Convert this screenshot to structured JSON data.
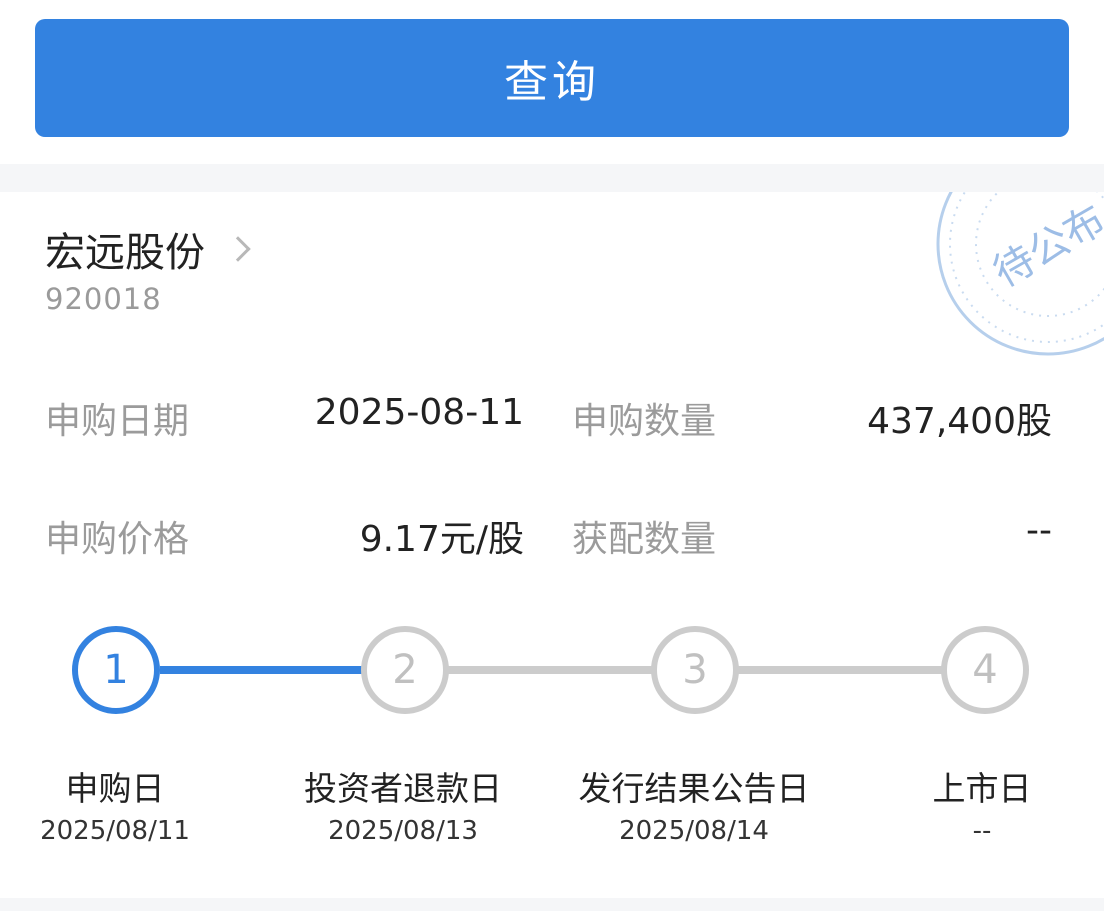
{
  "query_button": {
    "label": "查询"
  },
  "stock": {
    "name": "宏远股份",
    "code": "920018",
    "stamp_text": "待公布"
  },
  "details": {
    "subscribe_date": {
      "label": "申购日期",
      "value": "2025-08-11"
    },
    "subscribe_quantity": {
      "label": "申购数量",
      "value": "437,400股"
    },
    "subscribe_price": {
      "label": "申购价格",
      "value": "9.17元/股"
    },
    "allotted_quantity": {
      "label": "获配数量",
      "value": "--"
    }
  },
  "steps": [
    {
      "number": "1",
      "label": "申购日",
      "date": "2025/08/11",
      "status": "active"
    },
    {
      "number": "2",
      "label": "投资者退款日",
      "date": "2025/08/13",
      "status": "todo"
    },
    {
      "number": "3",
      "label": "发行结果公告日",
      "date": "2025/08/14",
      "status": "todo"
    },
    {
      "number": "4",
      "label": "上市日",
      "date": "--",
      "status": "todo"
    }
  ],
  "colors": {
    "accent": "#3382e0",
    "inactive": "#cccccc",
    "label_gray": "#9b9b9b",
    "text_dark": "#222222"
  }
}
